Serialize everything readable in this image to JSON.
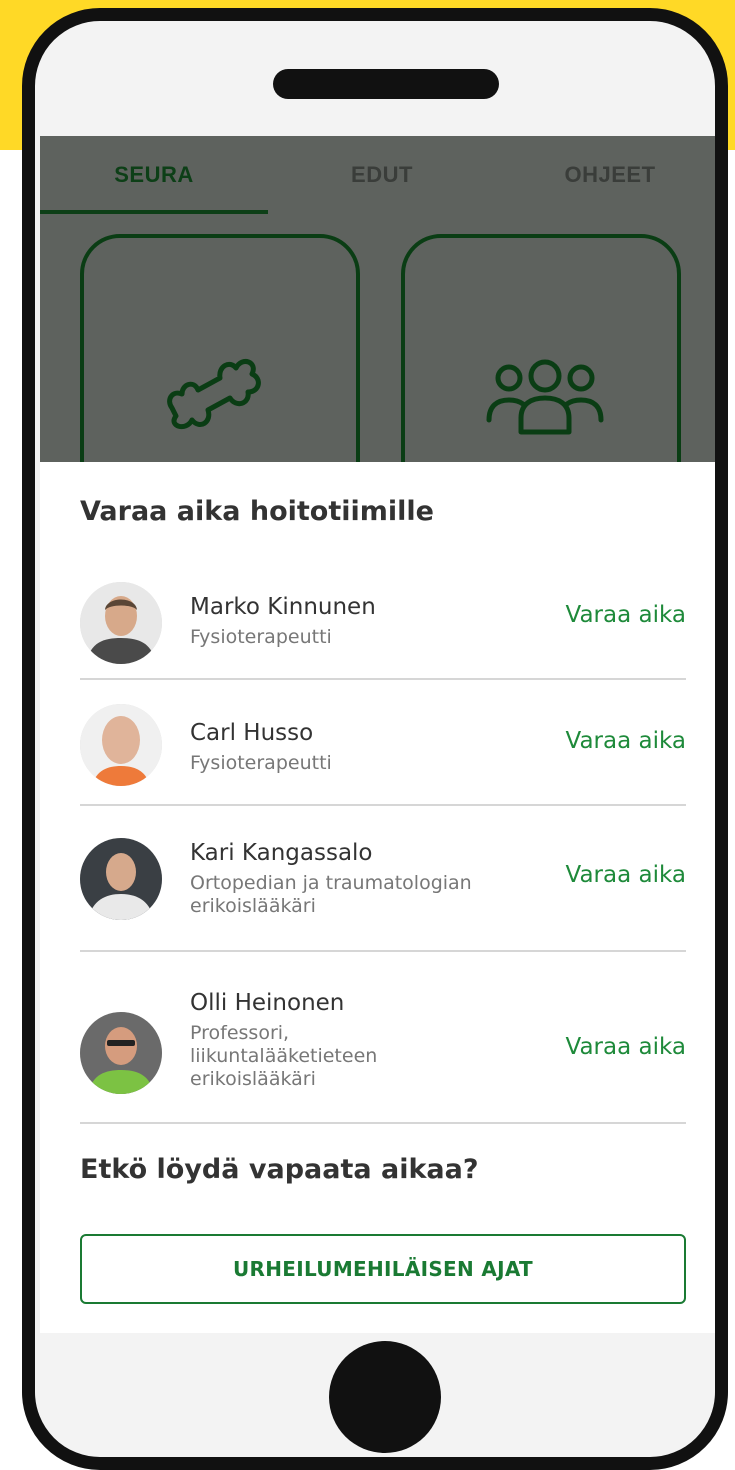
{
  "tabs": [
    {
      "label": "SEURA",
      "active": true
    },
    {
      "label": "EDUT",
      "active": false
    },
    {
      "label": "OHJEET",
      "active": false
    }
  ],
  "tiles": [
    {
      "icon": "bone-icon"
    },
    {
      "icon": "team-icon"
    }
  ],
  "sheet": {
    "title": "Varaa aika hoitotiimille",
    "people": [
      {
        "name": "Marko Kinnunen",
        "role": "Fysioterapeutti",
        "action": "Varaa aika"
      },
      {
        "name": "Carl Husso",
        "role": "Fysioterapeutti",
        "action": "Varaa aika"
      },
      {
        "name": "Kari Kangassalo",
        "role": "Ortopedian ja traumatologian erikoislääkäri",
        "action": "Varaa aika"
      },
      {
        "name": "Olli Heinonen",
        "role": "Professori, liikuntalääketieteen erikoislääkäri",
        "action": "Varaa aika"
      }
    ],
    "no_time_heading": "Etkö löydä vapaata aikaa?",
    "cta_label": "URHEILUMEHILÄISEN AJAT"
  },
  "colors": {
    "accent_green": "#1e8a3a",
    "dark_green": "#0d3f17",
    "background_band": "#ffd926"
  }
}
